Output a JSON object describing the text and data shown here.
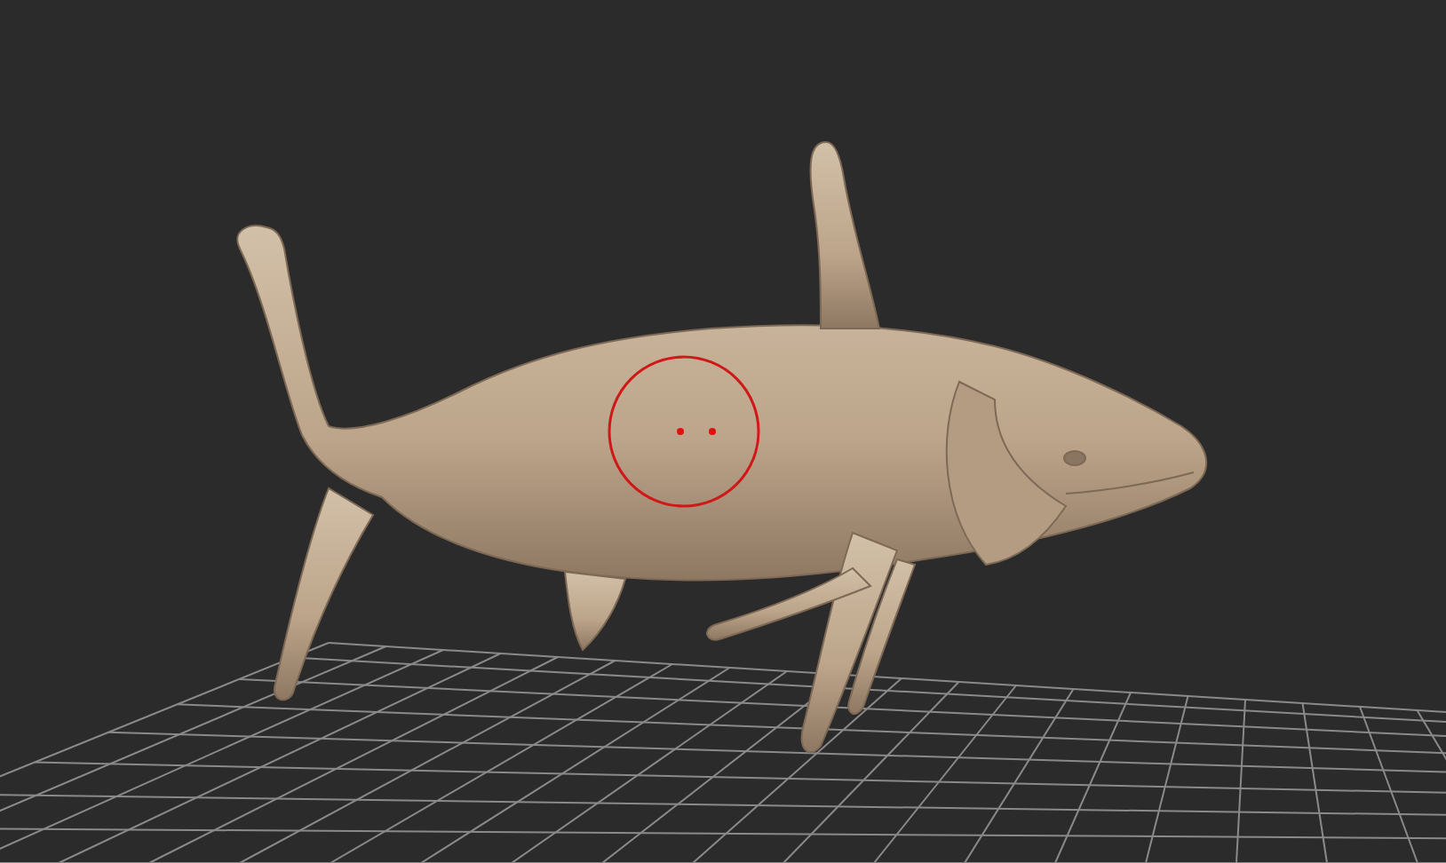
{
  "viewport": {
    "brush_cursor": {
      "shown": true
    }
  }
}
